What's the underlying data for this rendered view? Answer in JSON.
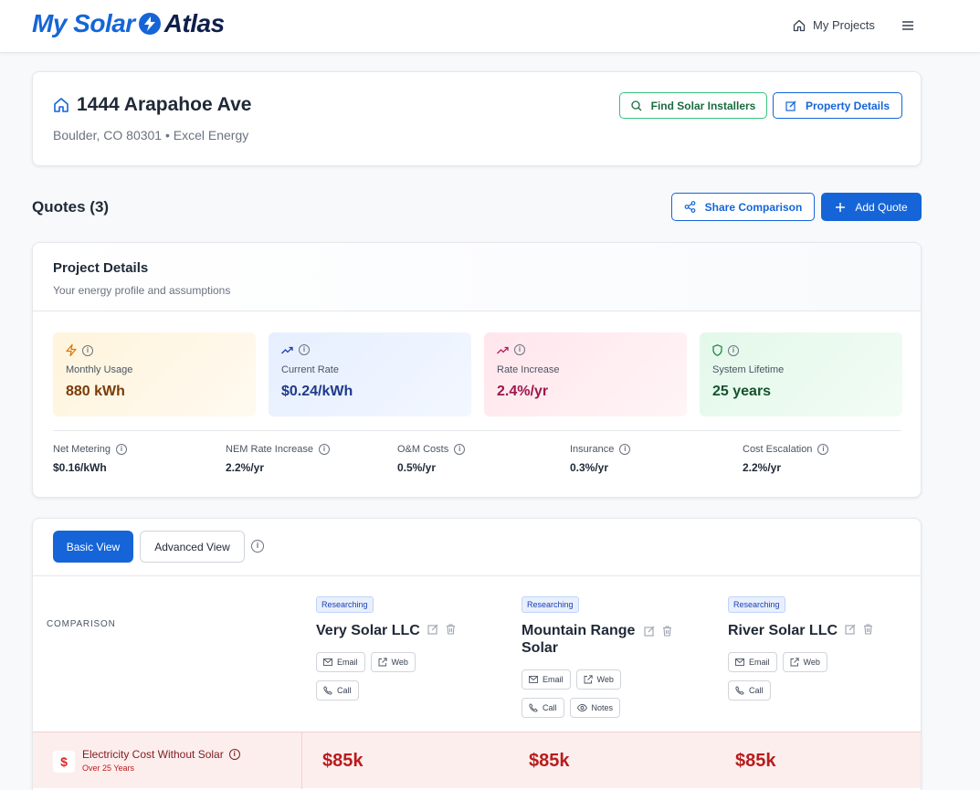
{
  "brand": {
    "name_part1": "My Solar",
    "name_part2": "Atlas"
  },
  "header": {
    "my_projects_label": "My Projects"
  },
  "property": {
    "address": "1444 Arapahoe Ave",
    "subtitle": "Boulder, CO 80301 • Excel Energy",
    "find_installers_label": "Find Solar Installers",
    "property_details_label": "Property Details"
  },
  "quotes": {
    "title": "Quotes (3)",
    "share_label": "Share Comparison",
    "add_label": "Add Quote"
  },
  "project_details": {
    "title": "Project Details",
    "subtitle": "Your energy profile and assumptions",
    "metrics": [
      {
        "label": "Monthly Usage",
        "value": "880 kWh",
        "icon": "bolt-icon",
        "color": "#d97706"
      },
      {
        "label": "Current Rate",
        "value": "$0.24/kWh",
        "icon": "trending-up-icon",
        "color": "#1e40af"
      },
      {
        "label": "Rate Increase",
        "value": "2.4%/yr",
        "icon": "trending-up-icon",
        "color": "#be185d"
      },
      {
        "label": "System Lifetime",
        "value": "25 years",
        "icon": "shield-icon",
        "color": "#15803d"
      }
    ],
    "secondary": [
      {
        "label": "Net Metering",
        "value": "$0.16/kWh"
      },
      {
        "label": "NEM Rate Increase",
        "value": "2.2%/yr"
      },
      {
        "label": "O&M Costs",
        "value": "0.5%/yr"
      },
      {
        "label": "Insurance",
        "value": "0.3%/yr"
      },
      {
        "label": "Cost Escalation",
        "value": "2.2%/yr"
      }
    ]
  },
  "comparison": {
    "basic_view_label": "Basic View",
    "advanced_view_label": "Advanced View",
    "comparison_label": "COMPARISON",
    "quotes": [
      {
        "status": "Researching",
        "name": "Very Solar LLC",
        "chips": [
          "Email",
          "Web",
          "Call"
        ]
      },
      {
        "status": "Researching",
        "name": "Mountain Range Solar",
        "chips": [
          "Email",
          "Web",
          "Call",
          "Notes"
        ]
      },
      {
        "status": "Researching",
        "name": "River Solar LLC",
        "chips": [
          "Email",
          "Web",
          "Call"
        ]
      }
    ],
    "cost_row": {
      "label": "Electricity Cost Without Solar",
      "sublabel": "Over 25 Years",
      "values": [
        "$85k",
        "$85k",
        "$85k"
      ]
    }
  },
  "colors": {
    "accent": "#1565d8",
    "success": "#34c47c",
    "danger": "#b91c1c"
  }
}
